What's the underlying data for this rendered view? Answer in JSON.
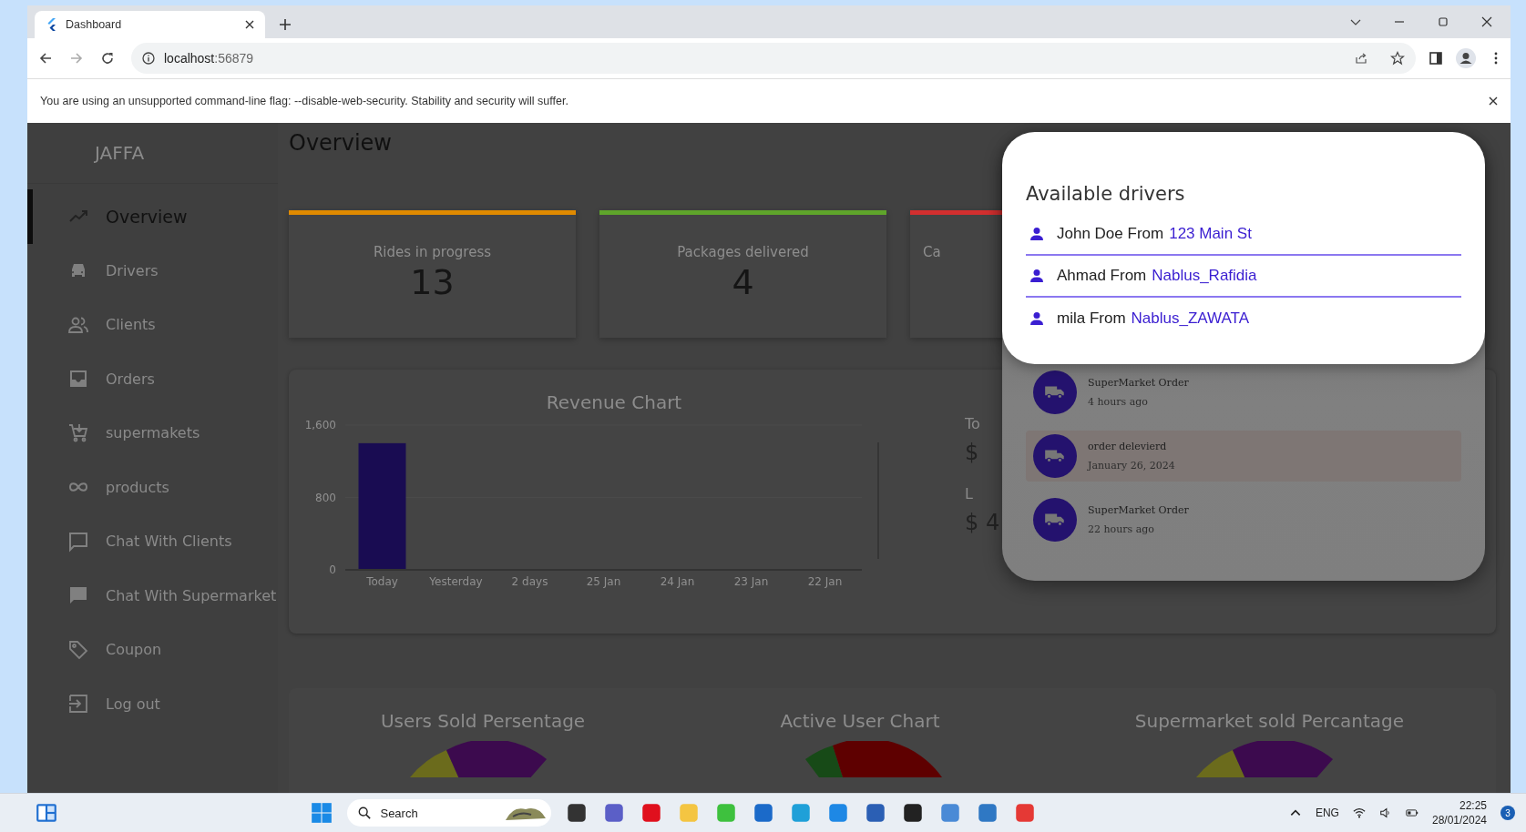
{
  "browser": {
    "tab_title": "Dashboard",
    "address_host": "localhost",
    "address_port": ":56879",
    "infobar": "You are using an unsupported command-line flag: --disable-web-security. Stability and security will suffer."
  },
  "sidebar": {
    "logo": "JAFFA",
    "items": [
      {
        "label": "Overview",
        "selected": true
      },
      {
        "label": "Drivers",
        "selected": false
      },
      {
        "label": "Clients",
        "selected": false
      },
      {
        "label": "Orders",
        "selected": false
      },
      {
        "label": "supermakets",
        "selected": false
      },
      {
        "label": "products",
        "selected": false
      },
      {
        "label": "Chat With Clients",
        "selected": false
      },
      {
        "label": "Chat With Supermarket",
        "selected": false
      },
      {
        "label": "Coupon",
        "selected": false
      },
      {
        "label": "Log out",
        "selected": false
      }
    ]
  },
  "page": {
    "title": "Overview"
  },
  "stat_cards": [
    {
      "label": "Rides in progress",
      "value": "13",
      "color": "#e08a00"
    },
    {
      "label": "Packages delivered",
      "value": "4",
      "color": "#5fa52b"
    },
    {
      "label": "Ca",
      "color": "#d32f2f"
    }
  ],
  "revenue": {
    "title": "Revenue Chart",
    "chart_data": {
      "type": "bar",
      "categories": [
        "Today",
        "Yesterday",
        "2 days",
        "25 Jan",
        "24 Jan",
        "23 Jan",
        "22 Jan"
      ],
      "values": [
        1400,
        0,
        0,
        0,
        0,
        0,
        0
      ],
      "ylim": [
        0,
        1600
      ],
      "yticks": [
        0,
        {
          "value": 800,
          "label": "800"
        },
        {
          "value": 1600,
          "label": "1,600"
        }
      ]
    },
    "totals_partial": [
      "To",
      "$",
      "L",
      "$ 4"
    ]
  },
  "bottom_charts": [
    {
      "title": "Users Sold Persentage"
    },
    {
      "title": "Active User Chart"
    },
    {
      "title": "Supermarket sold Percantage"
    }
  ],
  "notifications": [
    {
      "title": "SuperMarket Order",
      "time": "4 hours ago"
    },
    {
      "title": "order delevierd",
      "time": "January 26, 2024"
    },
    {
      "title": "SuperMarket Order",
      "time": "22 hours ago"
    }
  ],
  "drivers_dialog": {
    "title": "Available drivers",
    "drivers": [
      {
        "name": "John Doe From",
        "location": "123 Main St"
      },
      {
        "name": "Ahmad From",
        "location": "Nablus_Rafidia"
      },
      {
        "name": "mila From",
        "location": "Nablus_ZAWATA"
      }
    ]
  },
  "taskbar": {
    "search_placeholder": "Search",
    "language": "ENG",
    "time": "22:25",
    "date": "28/01/2024",
    "notification_count": "3"
  }
}
